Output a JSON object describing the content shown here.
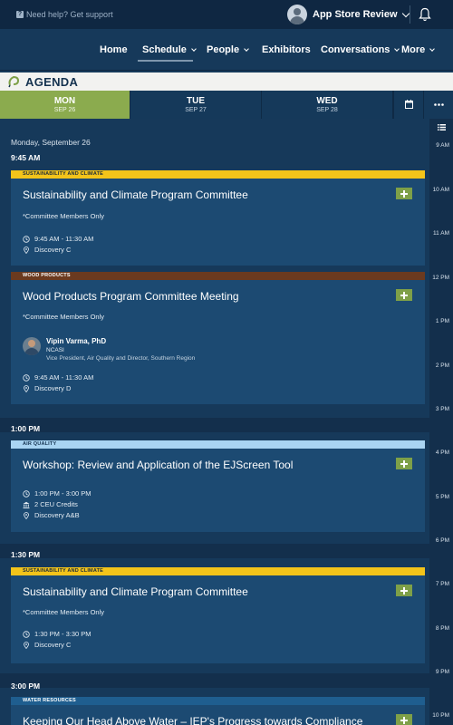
{
  "topbar": {
    "help_text": "Need help? Get support",
    "user_name": "App Store Review"
  },
  "nav": {
    "items": [
      {
        "label": "Home",
        "dropdown": false
      },
      {
        "label": "Schedule",
        "dropdown": true,
        "active": true
      },
      {
        "label": "People",
        "dropdown": true
      },
      {
        "label": "Exhibitors",
        "dropdown": false
      },
      {
        "label": "Conversations",
        "dropdown": true
      },
      {
        "label": "More",
        "dropdown": true
      }
    ]
  },
  "agenda": {
    "title": "AGENDA"
  },
  "days": [
    {
      "day": "MON",
      "date": "SEP 26",
      "active": true
    },
    {
      "day": "TUE",
      "date": "SEP 27",
      "active": false
    },
    {
      "day": "WED",
      "date": "SEP 28",
      "active": false
    }
  ],
  "timeline_hours": [
    "9 AM",
    "10 AM",
    "11 AM",
    "12 PM",
    "1 PM",
    "2 PM",
    "3 PM",
    "4 PM",
    "5 PM",
    "6 PM",
    "7 PM",
    "8 PM",
    "9 PM",
    "10 PM"
  ],
  "date_heading": "Monday, September 26",
  "slots": [
    "9:45 AM",
    "1:00 PM",
    "1:30 PM",
    "3:00 PM"
  ],
  "sessions": [
    {
      "tag": "SUSTAINABILITY AND CLIMATE",
      "tag_color": "#f3c41a",
      "tag_text_color": "#1b2a3a",
      "title": "Sustainability and Climate Program Committee",
      "note": "*Committee Members Only",
      "time": "9:45 AM - 11:30 AM",
      "location": "Discovery C"
    },
    {
      "tag": "WOOD PRODUCTS",
      "tag_color": "#6b3a1f",
      "tag_text_color": "#ffffff",
      "title": "Wood Products Program Committee Meeting",
      "note": "*Committee Members Only",
      "speaker": {
        "name": "Vipin Varma, PhD",
        "org": "NCASI",
        "role": "Vice President, Air Quality and Director, Southern Region"
      },
      "time": "9:45 AM - 11:30 AM",
      "location": "Discovery D"
    },
    {
      "tag": "AIR QUALITY",
      "tag_color": "#a9d4f2",
      "tag_text_color": "#14324f",
      "title": "Workshop: Review and Application of the EJScreen Tool",
      "time": "1:00 PM - 3:00 PM",
      "credits": "2 CEU Credits",
      "location": "Discovery A&B"
    },
    {
      "tag": "SUSTAINABILITY AND CLIMATE",
      "tag_color": "#f3c41a",
      "tag_text_color": "#1b2a3a",
      "title": "Sustainability and Climate Program Committee",
      "note": "*Committee Members Only",
      "time": "1:30 PM - 3:30 PM",
      "location": "Discovery C"
    },
    {
      "tag": "WATER RESOURCES",
      "tag_color": "#1f5e8f",
      "tag_text_color": "#ffffff",
      "title": "Keeping Our Head Above Water – IEP's Progress towards Compliance"
    }
  ],
  "colors": {
    "background": "#16395a",
    "card": "#1c4a72",
    "active_day": "#8bab4e",
    "add_button": "#7ea048"
  }
}
